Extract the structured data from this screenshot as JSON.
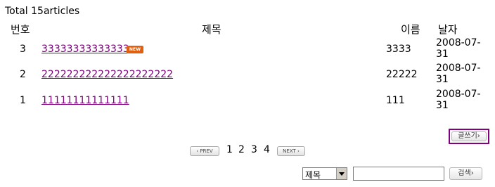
{
  "board": {
    "total_label": "Total 15articles",
    "headers": {
      "number": "번호",
      "title": "제목",
      "name": "이름",
      "date": "날자"
    },
    "rows": [
      {
        "number": "3",
        "title": "33333333333333",
        "badge": "NEW",
        "name": "3333",
        "date": "2008-07-31"
      },
      {
        "number": "2",
        "title": "222222222222222222222",
        "badge": "",
        "name": "22222",
        "date": "2008-07-31"
      },
      {
        "number": "1",
        "title": "11111111111111",
        "badge": "",
        "name": "111",
        "date": "2008-07-31"
      }
    ],
    "badge_color": "#e0600f",
    "link_color": "#800080"
  },
  "pagination": {
    "prev_label": "‹ PREV",
    "next_label": "NEXT ›",
    "pages": [
      "1",
      "2",
      "3",
      "4"
    ]
  },
  "actions": {
    "write_label": "글쓰기›"
  },
  "search": {
    "field_selected": "제목",
    "query_value": "",
    "button_label": "검색›"
  }
}
